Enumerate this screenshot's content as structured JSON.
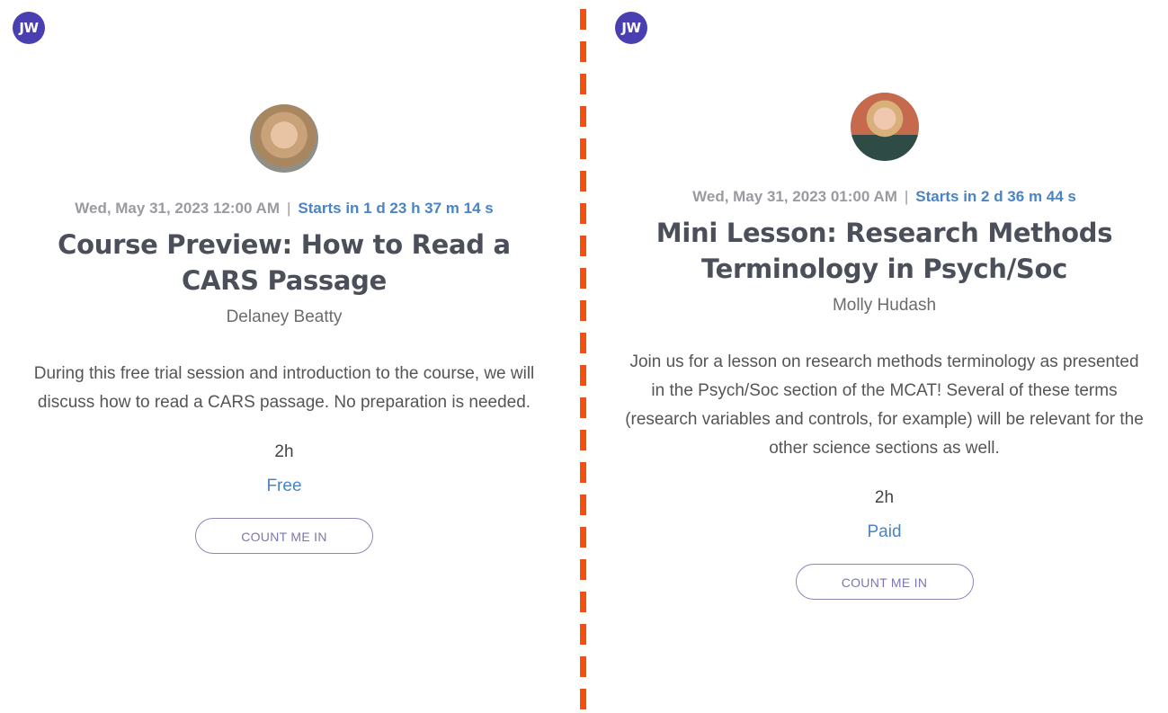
{
  "divider": {
    "color": "#f2500e",
    "style": "dashed-vertical"
  },
  "panels": [
    {
      "user_badge": "JW",
      "avatar_icon": "instructor-photo",
      "date": "Wed, May 31, 2023 12:00 AM",
      "separator": "|",
      "countdown": "Starts in 1 d 23 h 37 m 14 s",
      "title": "Course Preview: How to Read a CARS Passage",
      "instructor": "Delaney Beatty",
      "description": "During this free trial session and introduction to the course, we will discuss how to read a CARS passage. No preparation is needed.",
      "duration": "2h",
      "price": "Free",
      "cta_label": "COUNT ME IN"
    },
    {
      "user_badge": "JW",
      "avatar_icon": "instructor-photo",
      "date": "Wed, May 31, 2023 01:00 AM",
      "separator": "|",
      "countdown": "Starts in 2 d 36 m 44 s",
      "title": "Mini Lesson: Research Methods Terminology in Psych/Soc",
      "instructor": "Molly Hudash",
      "description": "Join us for a lesson on research methods terminology as presented in the Psych/Soc section of the MCAT! Several of these terms (research variables and controls, for example) will be relevant for the other science sections as well.",
      "duration": "2h",
      "price": "Paid",
      "cta_label": "COUNT ME IN"
    }
  ],
  "colors": {
    "badge": "#4a3fb0",
    "accent_blue": "#4a84c4",
    "title_text": "#4a4f5a",
    "button_border": "#8a87b8"
  }
}
